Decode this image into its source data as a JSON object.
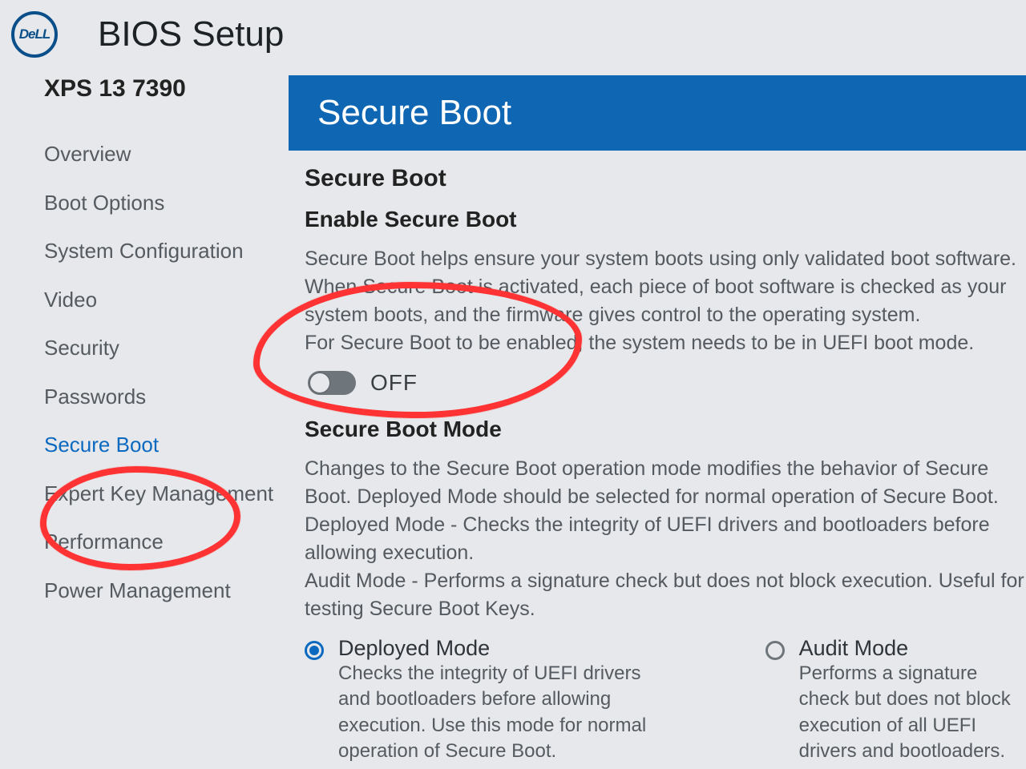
{
  "brand": "DeLL",
  "app_title": "BIOS Setup",
  "model": "XPS 13 7390",
  "sidebar": {
    "items": [
      {
        "label": "Overview"
      },
      {
        "label": "Boot Options"
      },
      {
        "label": "System Configuration"
      },
      {
        "label": "Video"
      },
      {
        "label": "Security"
      },
      {
        "label": "Passwords"
      },
      {
        "label": "Secure Boot"
      },
      {
        "label": "Expert Key Management"
      },
      {
        "label": "Performance"
      },
      {
        "label": "Power Management"
      }
    ],
    "selected_index": 6
  },
  "page": {
    "title": "Secure Boot",
    "section1": {
      "heading": "Secure Boot",
      "subheading": "Enable Secure Boot",
      "description": "Secure Boot helps ensure your system boots using only validated boot software. When Secure Boot is activated, each piece of boot software is checked as your system boots, and the firmware gives control to the operating system.\nFor Secure Boot to be enabled, the system needs to be in UEFI boot mode.",
      "toggle": {
        "state": "OFF"
      }
    },
    "section2": {
      "heading": "Secure Boot Mode",
      "description": "Changes to the Secure Boot operation mode modifies the behavior of Secure Boot. Deployed Mode should be selected for normal operation of Secure Boot.\n Deployed Mode - Checks the integrity of UEFI drivers and bootloaders before allowing execution.\n Audit Mode - Performs a signature check but does not block execution. Useful for testing Secure Boot Keys.",
      "options": [
        {
          "label": "Deployed Mode",
          "desc": "Checks the integrity of UEFI drivers and bootloaders before allowing execution. Use this mode for normal operation of Secure Boot.",
          "checked": true
        },
        {
          "label": "Audit Mode",
          "desc": "Performs a signature check but does not block execution of all UEFI drivers and bootloaders.",
          "checked": false
        }
      ]
    }
  }
}
